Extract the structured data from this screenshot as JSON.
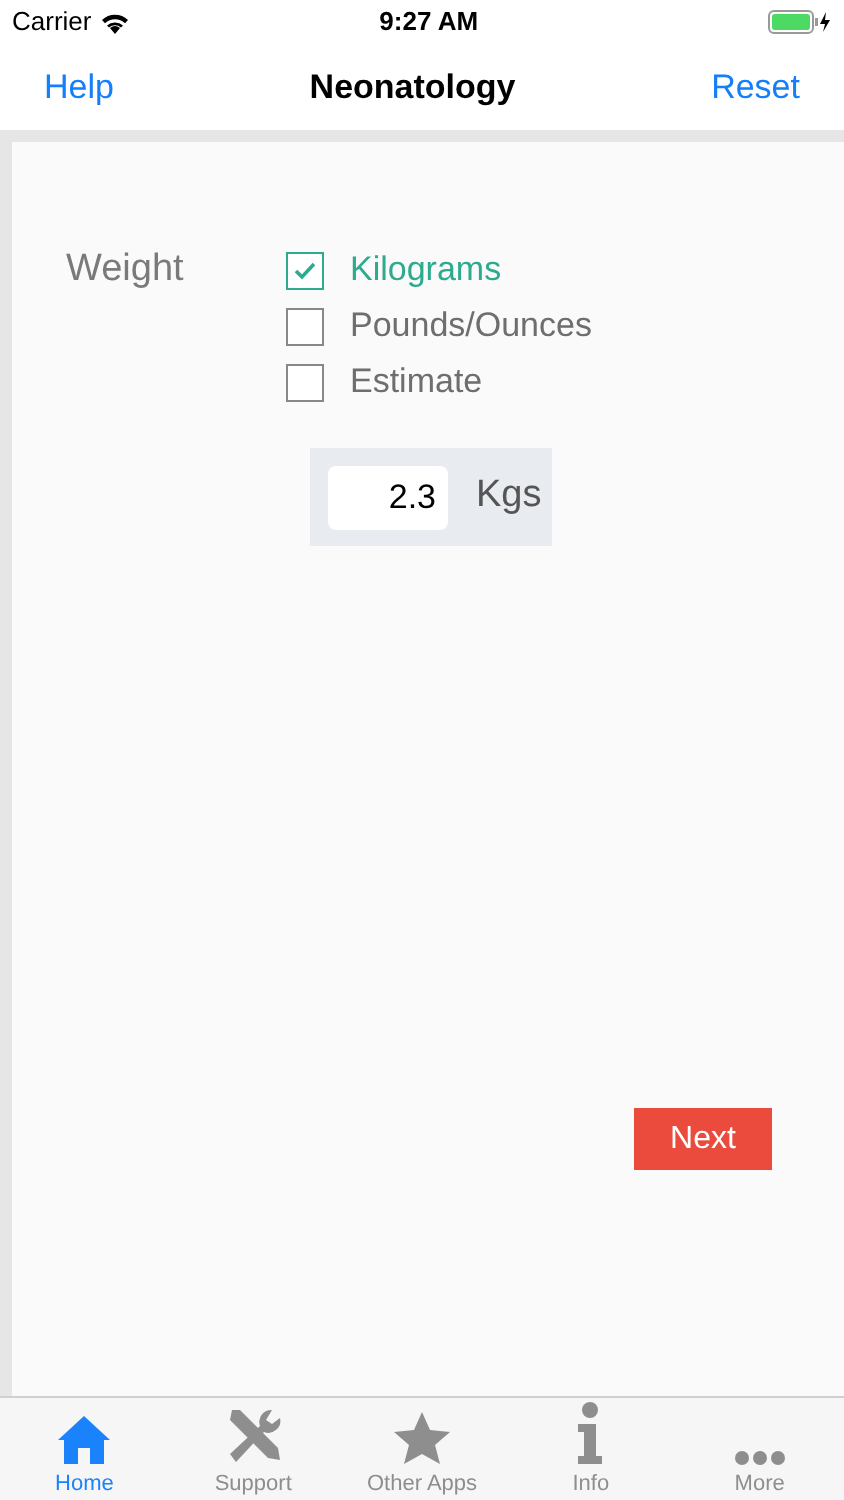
{
  "status_bar": {
    "carrier": "Carrier",
    "time": "9:27 AM"
  },
  "nav": {
    "left": "Help",
    "title": "Neonatology",
    "right": "Reset"
  },
  "weight": {
    "label": "Weight",
    "options": [
      {
        "label": "Kilograms",
        "checked": true
      },
      {
        "label": "Pounds/Ounces",
        "checked": false
      },
      {
        "label": "Estimate",
        "checked": false
      }
    ],
    "value": "2.3",
    "unit": "Kgs"
  },
  "next_button": "Next",
  "tabs": [
    {
      "label": "Home",
      "selected": true
    },
    {
      "label": "Support",
      "selected": false
    },
    {
      "label": "Other Apps",
      "selected": false
    },
    {
      "label": "Info",
      "selected": false
    },
    {
      "label": "More",
      "selected": false
    }
  ]
}
